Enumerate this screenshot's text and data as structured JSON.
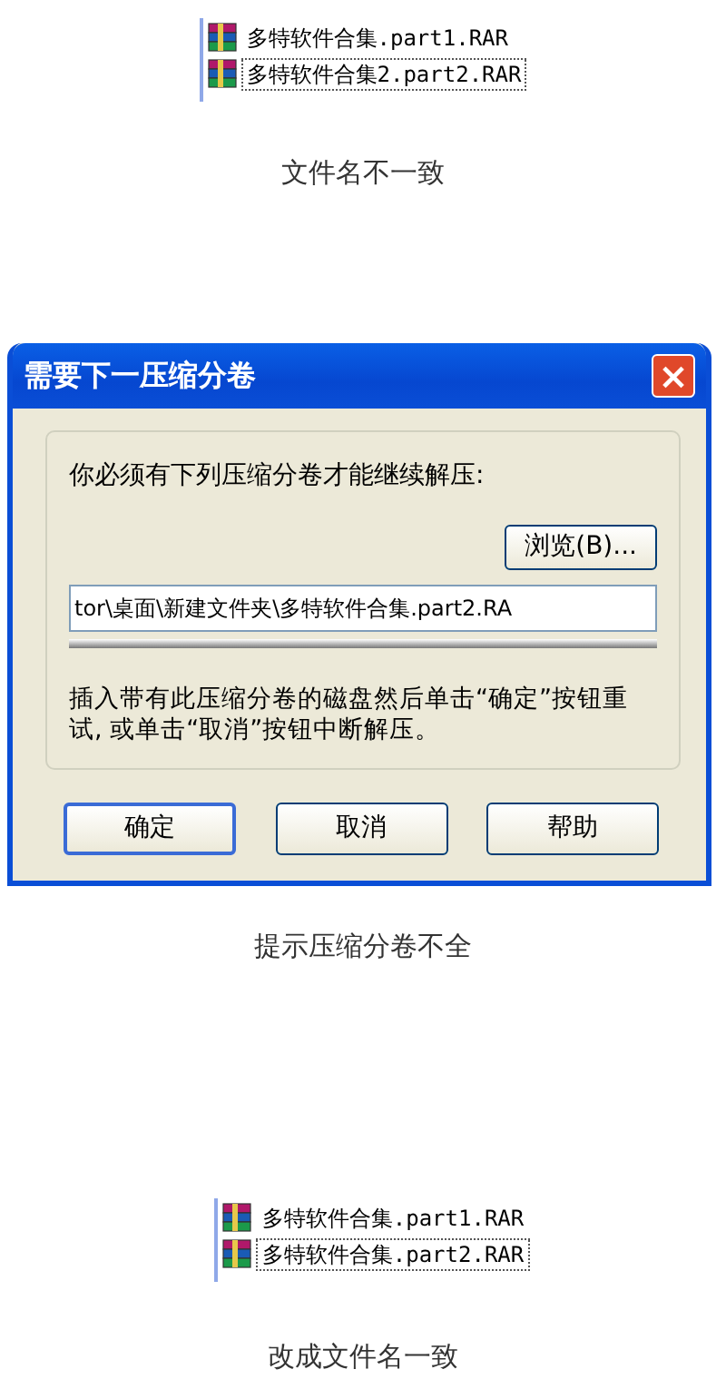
{
  "sections": [
    {
      "kind": "files",
      "files": [
        {
          "name": "多特软件合集.part1.RAR",
          "selected": false
        },
        {
          "name": "多特软件合集2.part2.RAR",
          "selected": true
        }
      ],
      "caption": "文件名不一致"
    },
    {
      "kind": "dialog",
      "title": "需要下一压缩分卷",
      "close": "×",
      "message": "你必须有下列压缩分卷才能继续解压:",
      "browse": "浏览(B)...",
      "path": "tor\\桌面\\新建文件夹\\多特软件合集.part2.RA",
      "hint": "插入带有此压缩分卷的磁盘然后单击“确定”按钮重试, 或单击“取消”按钮中断解压。",
      "buttons": [
        "确定",
        "取消",
        "帮助"
      ],
      "caption": "提示压缩分卷不全"
    },
    {
      "kind": "files",
      "files": [
        {
          "name": "多特软件合集.part1.RAR",
          "selected": false
        },
        {
          "name": "多特软件合集.part2.RAR",
          "selected": true
        }
      ],
      "caption": "改成文件名一致"
    }
  ]
}
